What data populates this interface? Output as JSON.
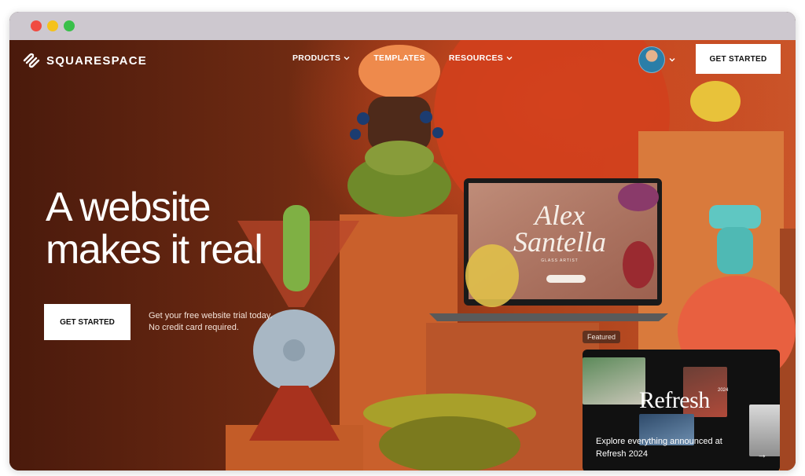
{
  "brand": {
    "name": "SQUARESPACE"
  },
  "nav": {
    "items": [
      {
        "label": "PRODUCTS",
        "has_dropdown": true
      },
      {
        "label": "TEMPLATES",
        "has_dropdown": false
      },
      {
        "label": "RESOURCES",
        "has_dropdown": true
      }
    ],
    "cta_label": "GET STARTED"
  },
  "hero": {
    "headline": "A website makes it real",
    "cta_label": "GET STARTED",
    "sub_line1": "Get your free website trial today.",
    "sub_line2": "No credit card required."
  },
  "laptop_screen": {
    "title_line1": "Alex",
    "title_line2": "Santella",
    "subtitle": "GLASS ARTIST"
  },
  "featured": {
    "tag": "Featured",
    "card_title": "Refresh",
    "card_year": "2024",
    "description": "Explore everything announced at Refresh 2024",
    "arrow_icon": "arrow-right-icon"
  },
  "colors": {
    "cta_bg": "#ffffff",
    "cta_text": "#111111",
    "hero_text": "#ffffff",
    "card_bg": "#111111"
  }
}
